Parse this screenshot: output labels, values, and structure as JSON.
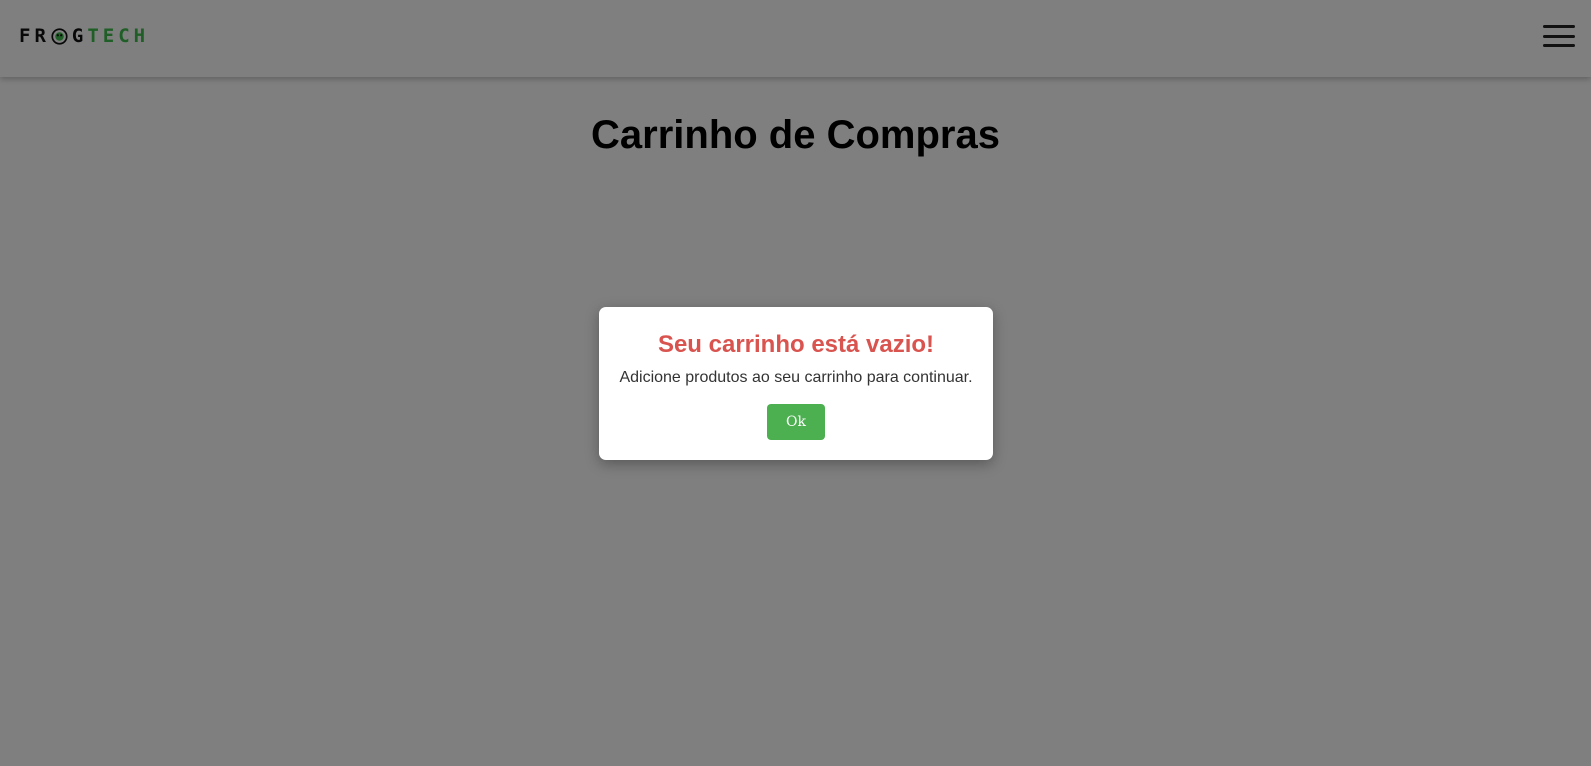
{
  "header": {
    "logo": {
      "part1_a": "FR",
      "part1_b": "G",
      "part2": "TECH",
      "icon": "frog-icon",
      "colors": {
        "dark": "#111111",
        "green": "#3fbf4f"
      }
    },
    "menu_icon": "hamburger-menu-icon"
  },
  "page": {
    "title": "Carrinho de Compras"
  },
  "modal": {
    "title": "Seu carrinho está vazio!",
    "message": "Adicione produtos ao seu carrinho para continuar.",
    "ok_label": "Ok",
    "colors": {
      "title": "#d9534f",
      "button": "#4caf50"
    }
  }
}
